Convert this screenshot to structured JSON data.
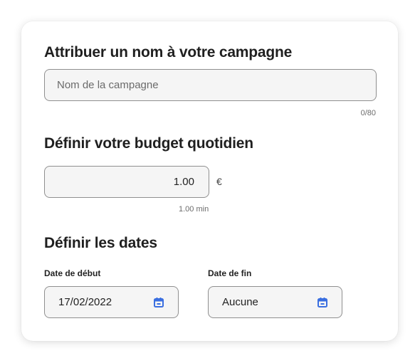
{
  "campaign_name": {
    "heading": "Attribuer un nom à votre campagne",
    "placeholder": "Nom de la campagne",
    "counter": "0/80"
  },
  "budget": {
    "heading": "Définir votre budget quotidien",
    "value": "1.00",
    "currency": "€",
    "min_hint": "1.00 min"
  },
  "dates": {
    "heading": "Définir les dates",
    "start": {
      "label": "Date de début",
      "value": "17/02/2022",
      "icon": "calendar-icon"
    },
    "end": {
      "label": "Date de fin",
      "value": "Aucune",
      "icon": "calendar-icon"
    }
  },
  "colors": {
    "accent": "#3b6fe0",
    "field_bg": "#f5f5f5",
    "field_border": "#8f8f8f"
  }
}
